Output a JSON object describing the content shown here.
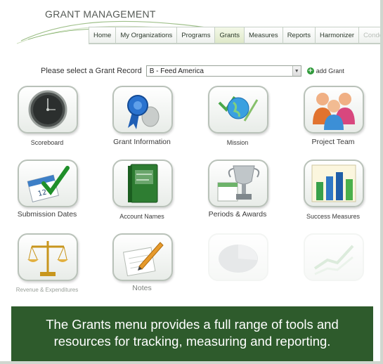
{
  "app": {
    "title": "GRANT MANAGEMENT"
  },
  "nav": {
    "tabs": [
      {
        "label": "Home"
      },
      {
        "label": "My Organizations"
      },
      {
        "label": "Programs"
      },
      {
        "label": "Grants",
        "active": true
      },
      {
        "label": "Measures"
      },
      {
        "label": "Reports"
      },
      {
        "label": "Harmonizer"
      },
      {
        "label": "Condens"
      }
    ]
  },
  "grant_select": {
    "label": "Please select a Grant Record",
    "value": "B - Feed America",
    "add_label": "add Grant"
  },
  "tiles": [
    {
      "label": "Scoreboard",
      "icon": "clock-icon"
    },
    {
      "label": "Grant Information",
      "icon": "ribbon-icon"
    },
    {
      "label": "Mission",
      "icon": "globe-icon"
    },
    {
      "label": "Project Team",
      "icon": "people-icon"
    },
    {
      "label": "Submission Dates",
      "icon": "calendar-check-icon"
    },
    {
      "label": "Account Names",
      "icon": "account-book-icon"
    },
    {
      "label": "Periods & Awards",
      "icon": "trophy-icon"
    },
    {
      "label": "Success Measures",
      "icon": "bar-chart-icon"
    },
    {
      "label": "Revenue & Expenditures",
      "icon": "scales-icon"
    },
    {
      "label": "Notes",
      "icon": "notes-icon"
    },
    {
      "label": "",
      "icon": "pie-chart-icon"
    },
    {
      "label": "",
      "icon": "line-chart-icon"
    }
  ],
  "caption": {
    "line1": "The Grants menu provides a full range of tools and",
    "line2": "resources for tracking, measuring and reporting."
  },
  "colors": {
    "caption_bg": "#2e5b2c",
    "active_tab": "#dfe9c9",
    "add_icon": "#2f9a3a"
  }
}
